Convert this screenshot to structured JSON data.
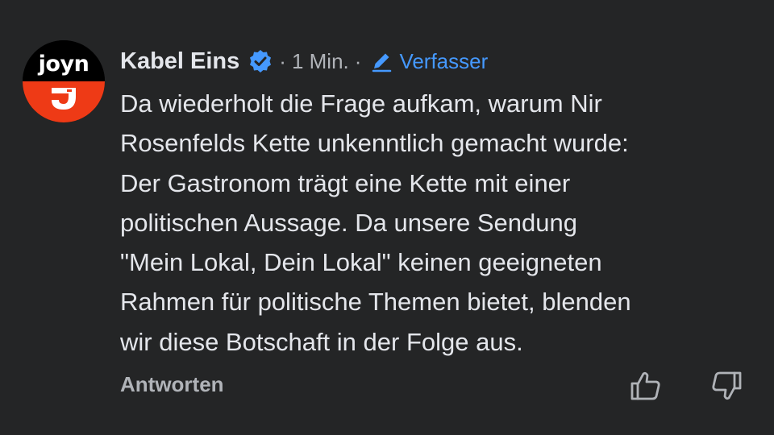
{
  "comment": {
    "author": "Kabel Eins",
    "avatar_logo": "joyn",
    "verified_icon": "verified-badge-icon",
    "time": "1 Min.",
    "role": "Verfasser",
    "text": "Da wiederholt die Frage aufkam, warum Nir\nRosenfelds Kette unkenntlich gemacht wurde:\nDer Gastronom trägt eine Kette mit einer\npolitischen Aussage. Da unsere Sendung\n\"Mein Lokal, Dein Lokal\" keinen geeigneten\nRahmen für politische Themen bietet, blenden\nwir diese Botschaft in der Folge aus.",
    "reply_label": "Antworten",
    "separator": "·"
  },
  "colors": {
    "background": "#242526",
    "text": "#e4e6eb",
    "secondary": "#b0b3b8",
    "accent": "#4599ff",
    "avatar_red": "#ee3a16"
  }
}
